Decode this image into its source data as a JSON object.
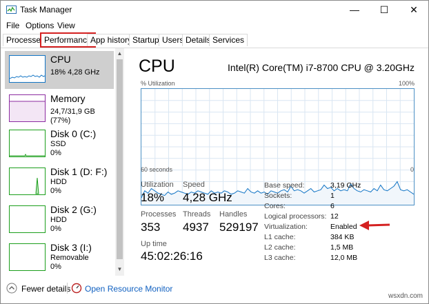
{
  "window": {
    "title": "Task Manager",
    "controls": [
      "—",
      "☐",
      "✕"
    ]
  },
  "menu": [
    "File",
    "Options",
    "View"
  ],
  "tabs": [
    "Processes",
    "Performance",
    "App history",
    "Startup",
    "Users",
    "Details",
    "Services"
  ],
  "active_tab": "Performance",
  "sidebar": {
    "items": [
      {
        "name": "CPU",
        "sub": [
          "18%  4,28 GHz"
        ],
        "selected": true,
        "color": "#1174c5"
      },
      {
        "name": "Memory",
        "sub": [
          "24,7/31,9 GB (77%)"
        ],
        "selected": false,
        "color": "#8b2aa0"
      },
      {
        "name": "Disk 0 (C:)",
        "sub": [
          "SSD",
          "0%"
        ],
        "selected": false,
        "color": "#1a9e1a"
      },
      {
        "name": "Disk 1 (D: F:)",
        "sub": [
          "HDD",
          "0%"
        ],
        "selected": false,
        "color": "#1a9e1a"
      },
      {
        "name": "Disk 2 (G:)",
        "sub": [
          "HDD",
          "0%"
        ],
        "selected": false,
        "color": "#1a9e1a"
      },
      {
        "name": "Disk 3 (I:)",
        "sub": [
          "Removable",
          "0%"
        ],
        "selected": false,
        "color": "#1a9e1a"
      }
    ]
  },
  "main": {
    "title": "CPU",
    "model": "Intel(R) Core(TM) i7-8700 CPU @ 3.20GHz",
    "graph": {
      "top_left": "% Utilization",
      "top_right": "100%",
      "bottom_left": "60 seconds",
      "bottom_right": "0",
      "line_color": "#1174c5",
      "fill_color": "#f1f6fb",
      "values": [
        6,
        12,
        10,
        14,
        12,
        10,
        9,
        8,
        11,
        9,
        10,
        12,
        11,
        10,
        9,
        11,
        10,
        12,
        11,
        10,
        9,
        12,
        10,
        11,
        10,
        12,
        11,
        9,
        10,
        12,
        11,
        10,
        14,
        11,
        10,
        12,
        10,
        11,
        9,
        12,
        11,
        10,
        12,
        13,
        11,
        16,
        12,
        13,
        12,
        10,
        12,
        14,
        11,
        12,
        13,
        17,
        14,
        15,
        12,
        14,
        12,
        13,
        12,
        18,
        14,
        12,
        11,
        13,
        12,
        11,
        14,
        12,
        17,
        13,
        12,
        14,
        16,
        20,
        13,
        12,
        13,
        11,
        9
      ]
    },
    "stats": {
      "utilization": {
        "label": "Utilization",
        "value": "18%"
      },
      "speed": {
        "label": "Speed",
        "value": "4,28 GHz"
      },
      "processes": {
        "label": "Processes",
        "value": "353"
      },
      "threads": {
        "label": "Threads",
        "value": "4937"
      },
      "handles": {
        "label": "Handles",
        "value": "529197"
      },
      "uptime": {
        "label": "Up time",
        "value": "45:02:26:16"
      }
    },
    "details": [
      {
        "label": "Base speed:",
        "value": "3,19 GHz"
      },
      {
        "label": "Sockets:",
        "value": "1"
      },
      {
        "label": "Cores:",
        "value": "6"
      },
      {
        "label": "Logical processors:",
        "value": "12"
      },
      {
        "label": "Virtualization:",
        "value": "Enabled"
      },
      {
        "label": "L1 cache:",
        "value": "384 KB"
      },
      {
        "label": "L2 cache:",
        "value": "1,5 MB"
      },
      {
        "label": "L3 cache:",
        "value": "12,0 MB"
      }
    ]
  },
  "footer": {
    "fewer": "Fewer details",
    "monitor": "Open Resource Monitor"
  },
  "watermark": "wsxdn.com",
  "colors": {
    "accent_red": "#d42020",
    "link_blue": "#1060c0"
  }
}
